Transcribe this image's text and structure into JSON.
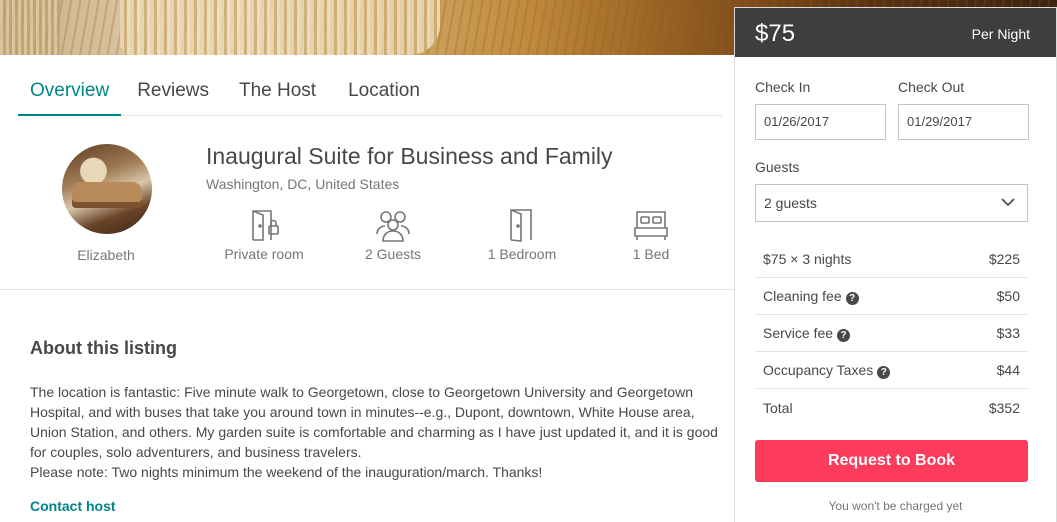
{
  "tabs": [
    {
      "label": "Overview",
      "active": true
    },
    {
      "label": "Reviews",
      "active": false
    },
    {
      "label": "The Host",
      "active": false
    },
    {
      "label": "Location",
      "active": false
    }
  ],
  "host": {
    "name": "Elizabeth"
  },
  "listing": {
    "title": "Inaugural Suite for Business and Family",
    "location": "Washington, DC, United States",
    "features": [
      {
        "icon": "door-lock-icon",
        "label": "Private room"
      },
      {
        "icon": "guests-icon",
        "label": "2 Guests"
      },
      {
        "icon": "door-icon",
        "label": "1 Bedroom"
      },
      {
        "icon": "bed-icon",
        "label": "1 Bed"
      }
    ]
  },
  "about": {
    "heading": "About this listing",
    "paragraph1": "The location is fantastic: Five minute walk to Georgetown, close to Georgetown University and Georgetown Hospital, and with buses that take you around town in minutes--e.g., Dupont, downtown, White House area, Union Station, and others. My garden suite is comfortable and charming as I have just updated it, and it is good for couples, solo adventurers, and business travelers.",
    "paragraph2": "Please note: Two nights minimum the weekend of the inauguration/march. Thanks!",
    "contact_label": "Contact host"
  },
  "booking": {
    "price": "$75",
    "per_night": "Per Night",
    "check_in_label": "Check In",
    "check_out_label": "Check Out",
    "check_in_value": "01/26/2017",
    "check_out_value": "01/29/2017",
    "guests_label": "Guests",
    "guests_value": "2 guests",
    "fees": [
      {
        "label": "$75 × 3 nights",
        "amount": "$225",
        "help": false
      },
      {
        "label": "Cleaning fee",
        "amount": "$50",
        "help": true
      },
      {
        "label": "Service fee",
        "amount": "$33",
        "help": true
      },
      {
        "label": "Occupancy Taxes",
        "amount": "$44",
        "help": true
      },
      {
        "label": "Total",
        "amount": "$352",
        "help": false
      }
    ],
    "help_glyph": "?",
    "book_label": "Request to Book",
    "note": "You won't be charged yet",
    "accent_color": "#fd3b5c"
  },
  "colors": {
    "teal": "#008489",
    "text": "#484848",
    "muted": "#767676",
    "panel_head": "#3e3e3e"
  }
}
